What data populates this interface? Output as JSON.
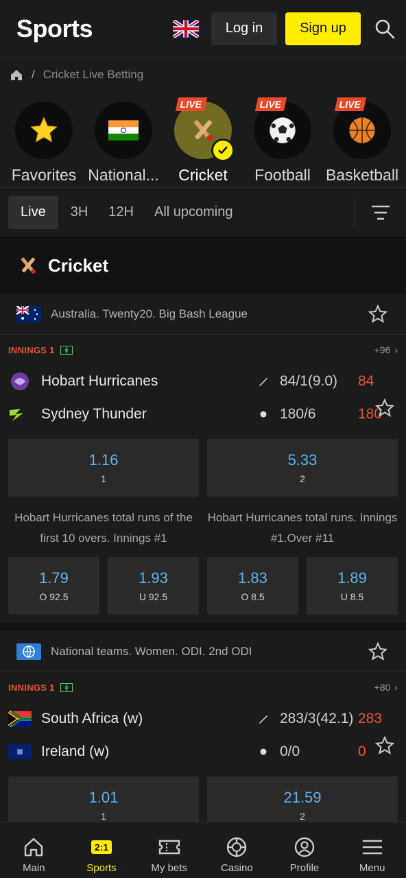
{
  "header": {
    "logo": "Sports",
    "login_label": "Log in",
    "signup_label": "Sign up",
    "search_icon": "search-icon",
    "language_icon": "uk-flag-icon"
  },
  "breadcrumb": {
    "home_icon": "home-icon",
    "separator": "/",
    "current": "Cricket Live Betting"
  },
  "categories": [
    {
      "label": "Favorites",
      "icon": "star-icon",
      "live": ""
    },
    {
      "label": "National...",
      "icon": "india-flag-icon",
      "live": ""
    },
    {
      "label": "Cricket",
      "icon": "cricket-icon",
      "live": "LIVE",
      "active": true
    },
    {
      "label": "Football",
      "icon": "football-icon",
      "live": "LIVE"
    },
    {
      "label": "Basketball",
      "icon": "basketball-icon",
      "live": "LIVE"
    }
  ],
  "filters": [
    "Live",
    "3H",
    "12H",
    "All upcoming"
  ],
  "section": {
    "title": "Cricket",
    "icon": "cricket-icon"
  },
  "matches": [
    {
      "league": "Australia. Twenty20. Big Bash League",
      "status": "INNINGS 1",
      "more": "+96",
      "team1": {
        "name": "Hobart Hurricanes",
        "detail": "84/1(9.0)",
        "score": "84"
      },
      "team2": {
        "name": "Sydney Thunder",
        "detail": "180/6",
        "score": "180"
      },
      "main_odds": [
        {
          "value": "1.16",
          "label": "1"
        },
        {
          "value": "5.33",
          "label": "2"
        }
      ],
      "market1": "Hobart Hurricanes total runs of the first 10 overs. Innings #1",
      "market2": "Hobart Hurricanes total runs. Innings #1.Over #11",
      "sub_odds": [
        {
          "value": "1.79",
          "label": "O 92.5"
        },
        {
          "value": "1.93",
          "label": "U 92.5"
        },
        {
          "value": "1.83",
          "label": "O 8.5"
        },
        {
          "value": "1.89",
          "label": "U 8.5"
        }
      ]
    },
    {
      "league": "National teams. Women. ODI. 2nd ODI",
      "status": "INNINGS 1",
      "more": "+80",
      "team1": {
        "name": "South Africa (w)",
        "detail": "283/3(42.1)",
        "score": "283"
      },
      "team2": {
        "name": "Ireland (w)",
        "detail": "0/0",
        "score": "0"
      },
      "main_odds": [
        {
          "value": "1.01",
          "label": "1"
        },
        {
          "value": "21.59",
          "label": "2"
        }
      ]
    }
  ],
  "bottom_nav": [
    {
      "label": "Main",
      "icon": "home-icon"
    },
    {
      "label": "Sports",
      "icon": "2:1",
      "active": true
    },
    {
      "label": "My bets",
      "icon": "ticket-icon"
    },
    {
      "label": "Casino",
      "icon": "chip-icon"
    },
    {
      "label": "Profile",
      "icon": "profile-icon"
    },
    {
      "label": "Menu",
      "icon": "menu-icon"
    }
  ],
  "colors": {
    "accent": "#ffee00",
    "live": "#e84a2a",
    "odds": "#5db4ec",
    "score": "#e8562d"
  }
}
